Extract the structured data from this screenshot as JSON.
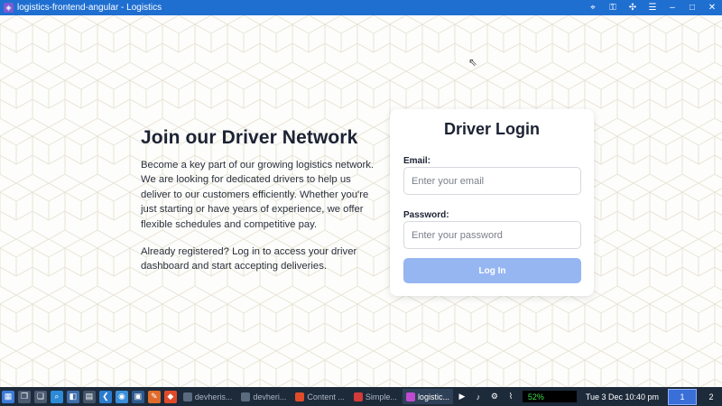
{
  "window": {
    "title": "logistics-frontend-angular - Logistics"
  },
  "info": {
    "heading": "Join our Driver Network",
    "paragraph1": "Become a key part of our growing logistics network. We are looking for dedicated drivers to help us deliver to our customers efficiently. Whether you're just starting or have years of experience, we offer flexible schedules and competitive pay.",
    "paragraph2": "Already registered? Log in to access your driver dashboard and start accepting deliveries."
  },
  "login": {
    "title": "Driver Login",
    "email_label": "Email:",
    "email_placeholder": "Enter your email",
    "password_label": "Password:",
    "password_placeholder": "Enter your password",
    "button_label": "Log In"
  },
  "taskbar": {
    "tasks": [
      "devheris...",
      "devheri...",
      "Content ...",
      "Simple...",
      "logistic..."
    ],
    "cpu": "52%",
    "clock": "Tue  3 Dec 10:40 pm",
    "workspace_active": "1",
    "workspace_other": "2"
  },
  "colors": {
    "titlebar": "#1f6fd1",
    "button": "#96b6f2",
    "taskbar": "#1d2a3a"
  }
}
